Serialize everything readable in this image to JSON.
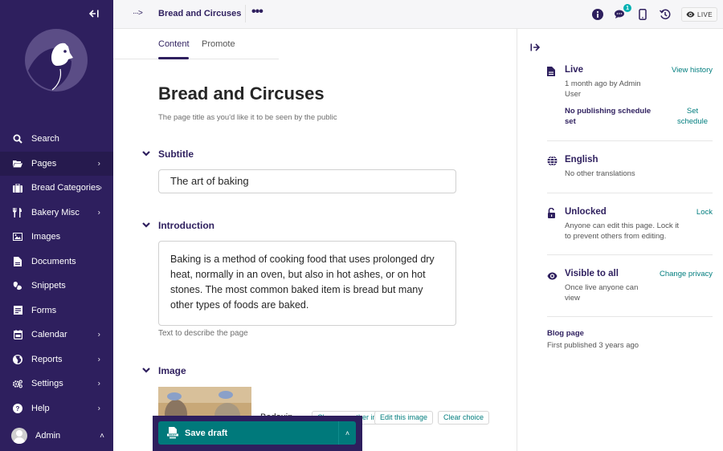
{
  "sidebar": {
    "collapse_icon": "arrow-left-bar-icon",
    "logo": "wagtail-bird-logo",
    "items": [
      {
        "label": "Search",
        "icon": "search-icon",
        "has_submenu": false,
        "active": false
      },
      {
        "label": "Pages",
        "icon": "folder-open-icon",
        "has_submenu": true,
        "active": true
      },
      {
        "label": "Bread Categories",
        "icon": "suitcase-icon",
        "has_submenu": true,
        "active": false
      },
      {
        "label": "Bakery Misc",
        "icon": "utensils-icon",
        "has_submenu": true,
        "active": false
      },
      {
        "label": "Images",
        "icon": "image-icon",
        "has_submenu": false,
        "active": false
      },
      {
        "label": "Documents",
        "icon": "document-icon",
        "has_submenu": false,
        "active": false
      },
      {
        "label": "Snippets",
        "icon": "snippets-icon",
        "has_submenu": false,
        "active": false
      },
      {
        "label": "Forms",
        "icon": "form-icon",
        "has_submenu": false,
        "active": false
      },
      {
        "label": "Calendar",
        "icon": "calendar-icon",
        "has_submenu": true,
        "active": false
      },
      {
        "label": "Reports",
        "icon": "globe-icon",
        "has_submenu": true,
        "active": false
      },
      {
        "label": "Settings",
        "icon": "cogs-icon",
        "has_submenu": true,
        "active": false
      },
      {
        "label": "Help",
        "icon": "help-icon",
        "has_submenu": true,
        "active": false
      }
    ],
    "account": {
      "name": "Admin"
    }
  },
  "header": {
    "breadcrumb_toggle": "···>",
    "page_title": "Bread and Circuses",
    "more_label": "•••",
    "comments_badge": "1",
    "live_label": "LIVE"
  },
  "tabs": [
    {
      "label": "Content",
      "active": true
    },
    {
      "label": "Promote",
      "active": false
    }
  ],
  "main": {
    "title": "Bread and Circuses",
    "title_help": "The page title as you'd like it to be seen by the public",
    "subtitle": {
      "label": "Subtitle",
      "value": "The art of baking"
    },
    "introduction": {
      "label": "Introduction",
      "value": "Baking is a method of cooking food that uses prolonged dry heat, normally in an oven, but also in hot ashes, or on hot stones. The most common baked item is bread but many other types of foods are baked.",
      "help": "Text to describe the page"
    },
    "image": {
      "label": "Image",
      "caption": "Bedouin",
      "buttons": [
        "Choose another image",
        "Edit this image",
        "Clear choice"
      ]
    }
  },
  "savebar": {
    "save_label": "Save draft",
    "icon_text": "DRAFT"
  },
  "panel": {
    "status": {
      "title": "Live",
      "text": "1 month ago by Admin User",
      "link": "View history",
      "schedule_text": "No publishing schedule set",
      "schedule_link": "Set schedule"
    },
    "locale": {
      "title": "English",
      "text": "No other translations"
    },
    "lock": {
      "title": "Unlocked",
      "text": "Anyone can edit this page. Lock it to prevent others from editing.",
      "link": "Lock"
    },
    "privacy": {
      "title": "Visible to all",
      "text": "Once live anyone can view",
      "link": "Change privacy"
    },
    "type": {
      "title": "Blog page",
      "text": "First published 3 years ago"
    }
  },
  "colors": {
    "sidebar_bg": "#2e1f5e",
    "accent_teal": "#00797b",
    "link_teal": "#007d7e",
    "primary_text": "#2e1f5e"
  }
}
